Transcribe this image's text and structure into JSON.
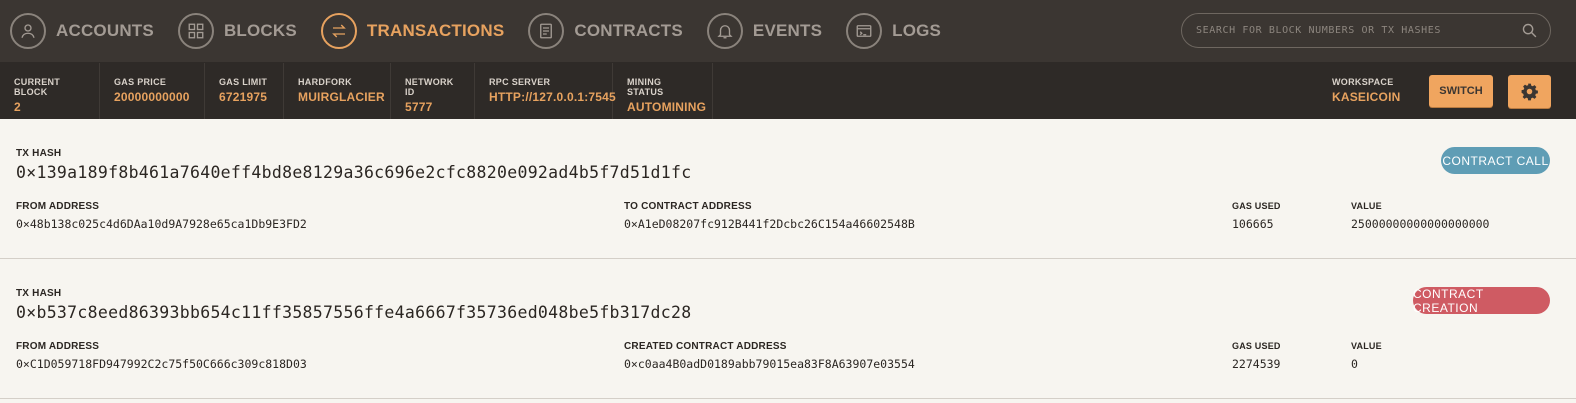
{
  "nav": {
    "items": [
      {
        "label": "ACCOUNTS",
        "icon": "account-icon"
      },
      {
        "label": "BLOCKS",
        "icon": "blocks-icon"
      },
      {
        "label": "TRANSACTIONS",
        "icon": "transactions-icon",
        "active": true
      },
      {
        "label": "CONTRACTS",
        "icon": "contracts-icon"
      },
      {
        "label": "EVENTS",
        "icon": "bell-icon"
      },
      {
        "label": "LOGS",
        "icon": "terminal-icon"
      }
    ],
    "search_placeholder": "SEARCH FOR BLOCK NUMBERS OR TX HASHES"
  },
  "status": {
    "current_block": {
      "label": "CURRENT BLOCK",
      "value": "2"
    },
    "gas_price": {
      "label": "GAS PRICE",
      "value": "20000000000"
    },
    "gas_limit": {
      "label": "GAS LIMIT",
      "value": "6721975"
    },
    "hardfork": {
      "label": "HARDFORK",
      "value": "MUIRGLACIER"
    },
    "network_id": {
      "label": "NETWORK ID",
      "value": "5777"
    },
    "rpc_server": {
      "label": "RPC SERVER",
      "value": "HTTP://127.0.0.1:7545"
    },
    "mining_status": {
      "label": "MINING STATUS",
      "value": "AUTOMINING"
    },
    "workspace": {
      "label": "WORKSPACE",
      "value": "KASEICOIN"
    },
    "switch_label": "SWITCH"
  },
  "transactions": [
    {
      "hash_label": "TX HASH",
      "hash": "0×139a189f8b461a7640eff4bd8e8129a36c696e2cfc8820e092ad4b5f7d51d1fc",
      "badge": "CONTRACT CALL",
      "from_label": "FROM ADDRESS",
      "from": "0×48b138c025c4d6DAa10d9A7928e65ca1Db9E3FD2",
      "to_label": "TO CONTRACT ADDRESS",
      "to": "0×A1eD08207fc912B441f2Dcbc26C154a46602548B",
      "gas_label": "GAS USED",
      "gas": "106665",
      "value_label": "VALUE",
      "value": "25000000000000000000"
    },
    {
      "hash_label": "TX HASH",
      "hash": "0×b537c8eed86393bb654c11ff35857556ffe4a6667f35736ed048be5fb317dc28",
      "badge": "CONTRACT CREATION",
      "from_label": "FROM ADDRESS",
      "from": "0×C1D059718FD947992C2c75f50C666c309c818D03",
      "to_label": "CREATED CONTRACT ADDRESS",
      "to": "0×c0aa4B0adD0189abb79015ea83F8A63907e03554",
      "gas_label": "GAS USED",
      "gas": "2274539",
      "value_label": "VALUE",
      "value": "0"
    }
  ],
  "colors": {
    "nav_bg": "#3b3632",
    "status_bg": "#2e2a27",
    "accent": "#e7a25f",
    "badge_call": "#5f9db5",
    "badge_creation": "#cf5b63"
  }
}
